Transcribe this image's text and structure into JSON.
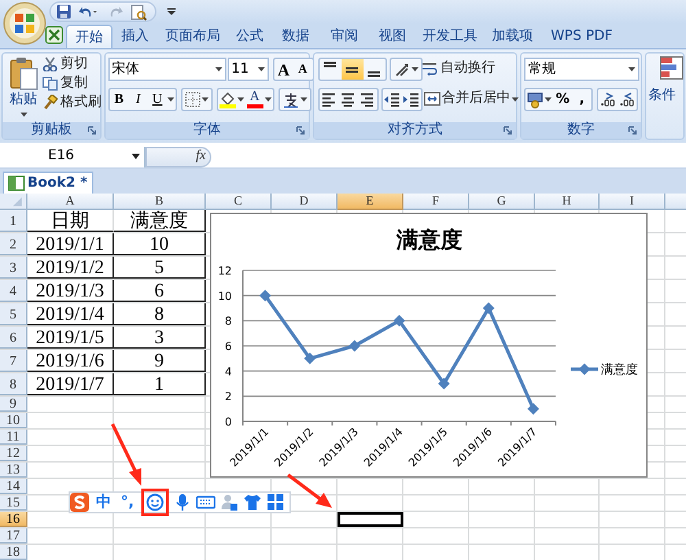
{
  "tabs": [
    {
      "label": "开始",
      "selected": true
    },
    {
      "label": "插入",
      "selected": false
    },
    {
      "label": "页面布局",
      "selected": false
    },
    {
      "label": "公式",
      "selected": false
    },
    {
      "label": "数据",
      "selected": false
    },
    {
      "label": "审阅",
      "selected": false
    },
    {
      "label": "视图",
      "selected": false
    },
    {
      "label": "开发工具",
      "selected": false
    },
    {
      "label": "加载项",
      "selected": false
    },
    {
      "label": "WPS PDF",
      "selected": false
    }
  ],
  "ribbon": {
    "clipboard": {
      "label": "剪贴板",
      "paste": "粘贴",
      "actions": [
        "剪切",
        "复制",
        "格式刷"
      ]
    },
    "font": {
      "label": "字体",
      "font_name": "宋体",
      "font_size": "11",
      "size_buttons": [
        "A",
        "A"
      ],
      "style_buttons": [
        "B",
        "I",
        "U"
      ],
      "font_color_button": "A"
    },
    "alignment": {
      "label": "对齐方式",
      "vertical_align": [
        {
          "selected": false
        },
        {
          "selected": true
        },
        {
          "selected": false
        }
      ],
      "wrap_text": "自动换行",
      "merge_center": "合并后居中"
    },
    "number": {
      "label": "数字",
      "format": "常规",
      "buttons": [
        "%",
        ","
      ]
    },
    "styles": {
      "conditional_format": "条件"
    }
  },
  "formula_bar": {
    "name_box": "E16",
    "fx": "fx"
  },
  "workbook_tab": "Book2 *",
  "sheet": {
    "columns": [
      {
        "label": "A",
        "selected": false
      },
      {
        "label": "B",
        "selected": false
      },
      {
        "label": "C",
        "selected": false
      },
      {
        "label": "D",
        "selected": false
      },
      {
        "label": "E",
        "selected": true
      },
      {
        "label": "F",
        "selected": false
      },
      {
        "label": "G",
        "selected": false
      },
      {
        "label": "H",
        "selected": false
      },
      {
        "label": "I",
        "selected": false
      }
    ],
    "rows": [
      {
        "label": "1",
        "selected": false,
        "cells": [
          "日期",
          "满意度"
        ]
      },
      {
        "label": "2",
        "selected": false,
        "cells": [
          "2019/1/1",
          "10"
        ]
      },
      {
        "label": "3",
        "selected": false,
        "cells": [
          "2019/1/2",
          "5"
        ]
      },
      {
        "label": "4",
        "selected": false,
        "cells": [
          "2019/1/3",
          "6"
        ]
      },
      {
        "label": "5",
        "selected": false,
        "cells": [
          "2019/1/4",
          "8"
        ]
      },
      {
        "label": "6",
        "selected": false,
        "cells": [
          "2019/1/5",
          "3"
        ]
      },
      {
        "label": "7",
        "selected": false,
        "cells": [
          "2019/1/6",
          "9"
        ]
      },
      {
        "label": "8",
        "selected": false,
        "cells": [
          "2019/1/7",
          "1"
        ]
      },
      {
        "label": "9",
        "selected": false,
        "cells": []
      },
      {
        "label": "10",
        "selected": false,
        "cells": []
      },
      {
        "label": "11",
        "selected": false,
        "cells": []
      },
      {
        "label": "12",
        "selected": false,
        "cells": []
      },
      {
        "label": "13",
        "selected": false,
        "cells": []
      },
      {
        "label": "14",
        "selected": false,
        "cells": []
      },
      {
        "label": "15",
        "selected": false,
        "cells": []
      },
      {
        "label": "16",
        "selected": true,
        "cells": []
      },
      {
        "label": "17",
        "selected": false,
        "cells": []
      },
      {
        "label": "18",
        "selected": false,
        "cells": []
      }
    ]
  },
  "chart": {
    "chart_data": {
      "type": "line",
      "title": "满意度",
      "categories": [
        "2019/1/1",
        "2019/1/2",
        "2019/1/3",
        "2019/1/4",
        "2019/1/5",
        "2019/1/6",
        "2019/1/7"
      ],
      "series": [
        {
          "name": "满意度",
          "color": "#4f81bd",
          "marker": "diamond",
          "values": [
            10,
            5,
            6,
            8,
            3,
            9,
            1
          ]
        }
      ],
      "grid": true,
      "ylim": [
        0,
        12
      ],
      "yticks": [
        0,
        2,
        4,
        6,
        8,
        10,
        12
      ]
    }
  },
  "ime_toolbar": {
    "items": [
      {
        "kind": "logo"
      },
      {
        "kind": "text",
        "label": "中"
      },
      {
        "kind": "text",
        "label": "°,"
      },
      {
        "kind": "emoji",
        "highlighted": true
      },
      {
        "kind": "mic"
      },
      {
        "kind": "keyboard"
      },
      {
        "kind": "user"
      },
      {
        "kind": "skin"
      },
      {
        "kind": "grid"
      }
    ]
  }
}
